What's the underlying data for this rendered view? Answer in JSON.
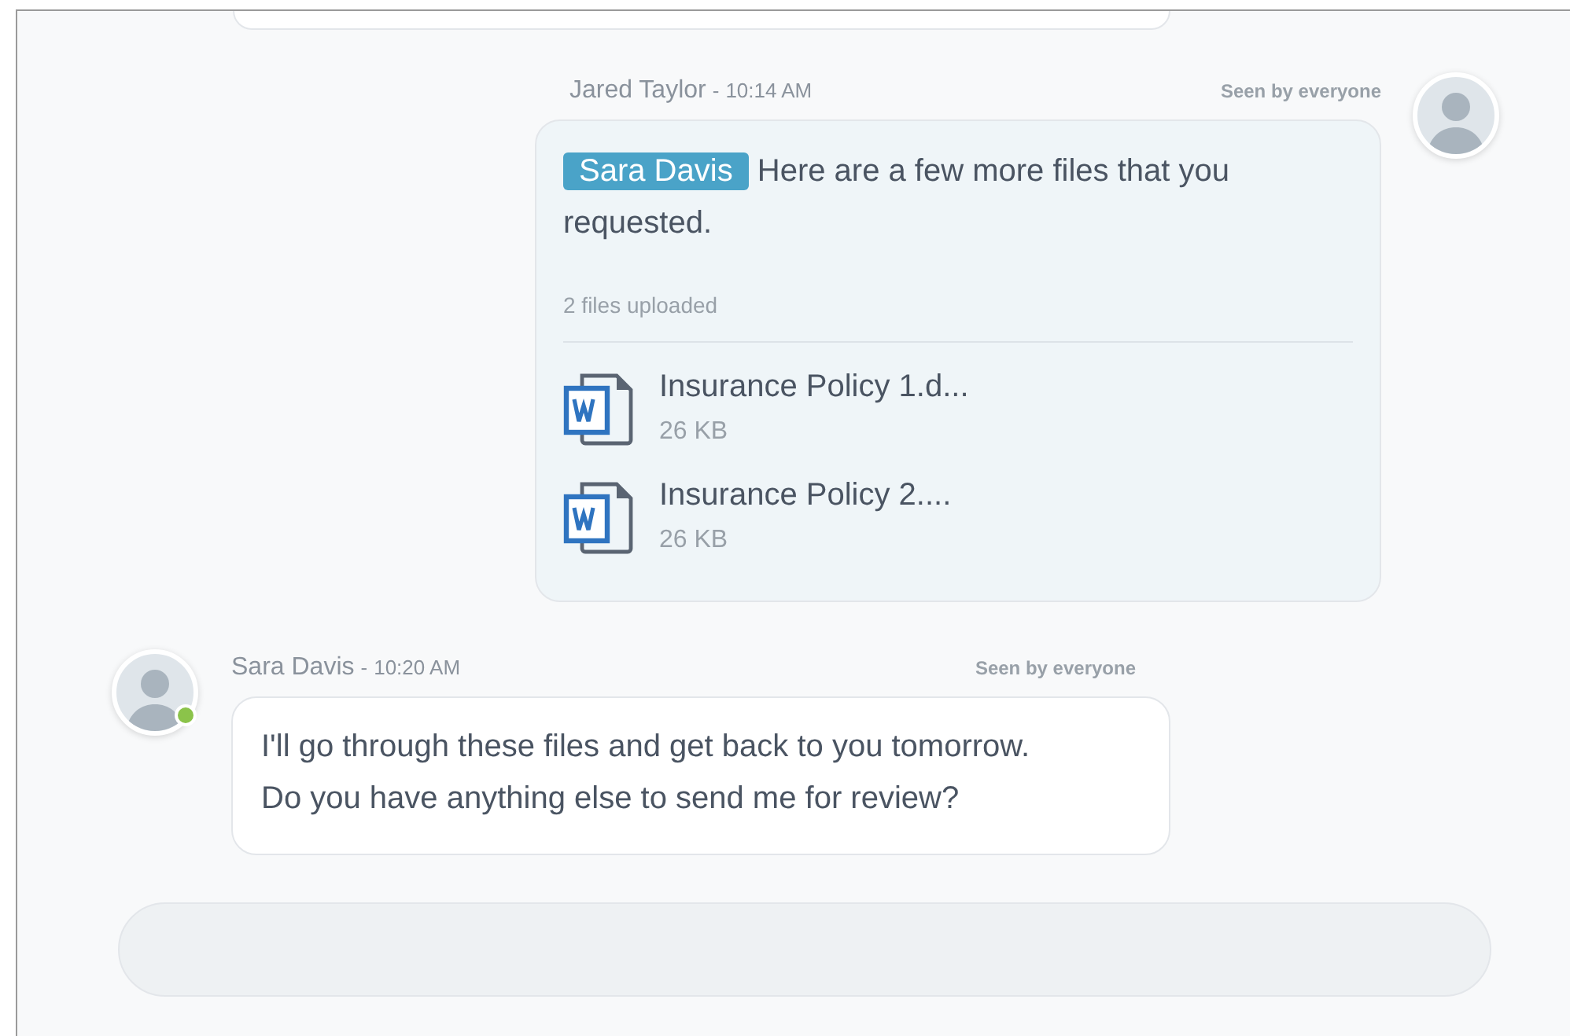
{
  "messages": [
    {
      "kind": "outgoing",
      "sender": "Jared Taylor",
      "separator": "-",
      "time": "10:14 AM",
      "seen": "Seen by everyone",
      "online": false,
      "mention": "Sara Davis",
      "text": "Here are a few more files that you requested.",
      "files_label": "2 files uploaded",
      "files": [
        {
          "name": "Insurance Policy 1.d...",
          "size": "26 KB"
        },
        {
          "name": "Insurance Policy 2....",
          "size": "26 KB"
        }
      ]
    },
    {
      "kind": "incoming",
      "sender": "Sara Davis",
      "separator": "-",
      "time": "10:20 AM",
      "seen": "Seen by everyone",
      "online": true,
      "text": "I'll go through these files and get back to you tomorrow. Do you have anything else to send me for review?"
    }
  ]
}
